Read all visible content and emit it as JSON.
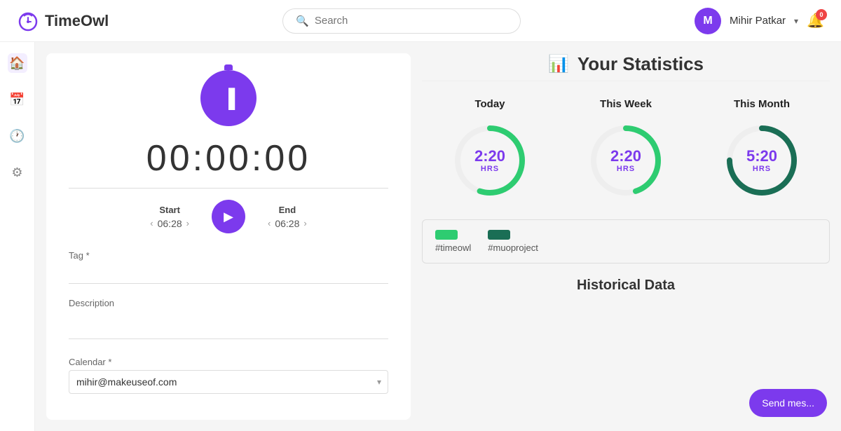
{
  "header": {
    "logo_text": "TimeOwl",
    "search_placeholder": "Search",
    "user": {
      "initial": "M",
      "name": "Mihir Patkar"
    },
    "bell_badge": "0"
  },
  "sidebar": {
    "items": [
      {
        "icon": "🏠",
        "name": "home",
        "active": true
      },
      {
        "icon": "📅",
        "name": "calendar",
        "active": false
      },
      {
        "icon": "🕐",
        "name": "history",
        "active": false
      },
      {
        "icon": "⚙",
        "name": "settings",
        "active": false
      }
    ]
  },
  "timer": {
    "display": "00:00:00",
    "start_label": "Start",
    "start_value": "06:28",
    "end_label": "End",
    "end_value": "06:28"
  },
  "form": {
    "tag_label": "Tag *",
    "tag_placeholder": "",
    "description_label": "Description",
    "description_placeholder": "",
    "calendar_label": "Calendar *",
    "calendar_value": "mihir@makeuseof.com"
  },
  "statistics": {
    "title": "Your Statistics",
    "periods": [
      {
        "label": "Today",
        "value": "2:20",
        "unit": "HRS",
        "progress": 0.55,
        "color": "#2ecc71"
      },
      {
        "label": "This Week",
        "value": "2:20",
        "unit": "HRS",
        "progress": 0.45,
        "color": "#2ecc71"
      },
      {
        "label": "This Month",
        "value": "5:20",
        "unit": "HRS",
        "progress": 0.75,
        "color": "#1a6e55"
      }
    ],
    "legend": [
      {
        "label": "#timeowl",
        "color": "#2ecc71"
      },
      {
        "label": "#muoproject",
        "color": "#1a6e55"
      }
    ],
    "historical_label": "Historical Data"
  },
  "chat_button": {
    "label": "Send mes..."
  }
}
